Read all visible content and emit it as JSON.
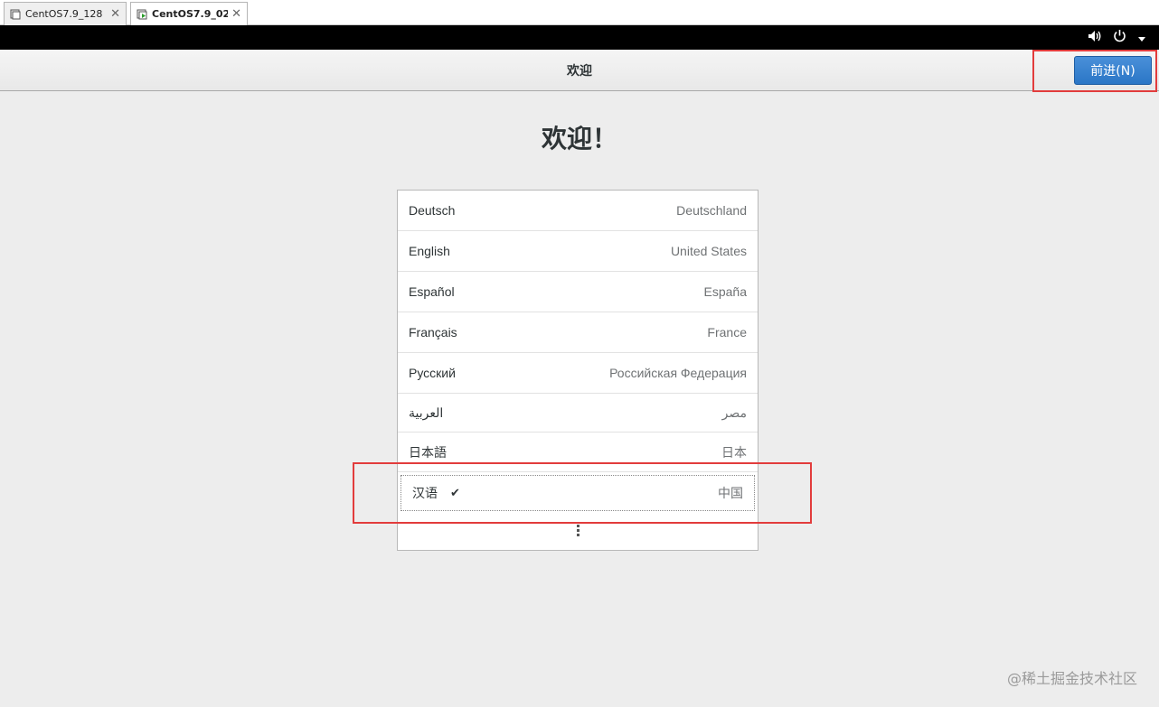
{
  "vm_tabs": [
    {
      "label": "CentOS7.9_128",
      "close": "✕"
    },
    {
      "label": "CentOS7.9_02",
      "close": "✕"
    }
  ],
  "header": {
    "title": "欢迎",
    "next_button": "前进(N)"
  },
  "welcome_heading": "欢迎！",
  "languages": [
    {
      "native": "Deutsch",
      "region": "Deutschland"
    },
    {
      "native": "English",
      "region": "United States"
    },
    {
      "native": "Español",
      "region": "España"
    },
    {
      "native": "Français",
      "region": "France"
    },
    {
      "native": "Русский",
      "region": "Российская Федерация"
    },
    {
      "native": "العربية",
      "region": "مصر"
    },
    {
      "native": "日本語",
      "region": "日本"
    },
    {
      "native": "汉语",
      "region": "中国",
      "selected": true
    }
  ],
  "selected_check": "✔",
  "watermark": "@稀土掘金技术社区",
  "colors": {
    "accent": "#3584e4",
    "annotation": "#e23c3c"
  },
  "icons": {
    "volume": "volume-icon",
    "power": "power-icon",
    "menu": "chevron-down-icon"
  }
}
